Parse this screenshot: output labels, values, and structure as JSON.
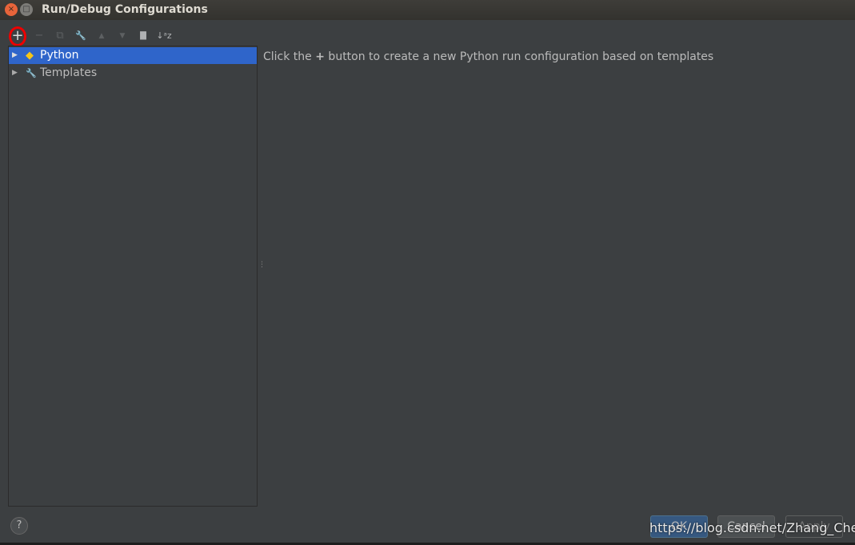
{
  "window": {
    "title": "Run/Debug Configurations",
    "close_icon": "×",
    "maximize_icon": "□"
  },
  "toolbar": {
    "add": "+",
    "remove": "−",
    "copy": "⧉",
    "edit": "🔧",
    "up": "▲",
    "down": "▼",
    "folder": "▇",
    "sort": "↓ᵃz"
  },
  "tree": {
    "items": [
      {
        "label": "Python",
        "selected": true
      },
      {
        "label": "Templates",
        "selected": false
      }
    ]
  },
  "main": {
    "hint_before": "Click the ",
    "hint_icon": "+",
    "hint_after": " button to create a new Python run configuration based on templates"
  },
  "footer": {
    "help": "?",
    "ok": "OK",
    "cancel": "Cancel",
    "apply": "Apply"
  },
  "watermark": "https://blog.csdn.net/Zhang_Chen_",
  "colors": {
    "background": "#3c3f41",
    "selection": "#2f65ca",
    "highlight_ring": "#ee0000"
  }
}
